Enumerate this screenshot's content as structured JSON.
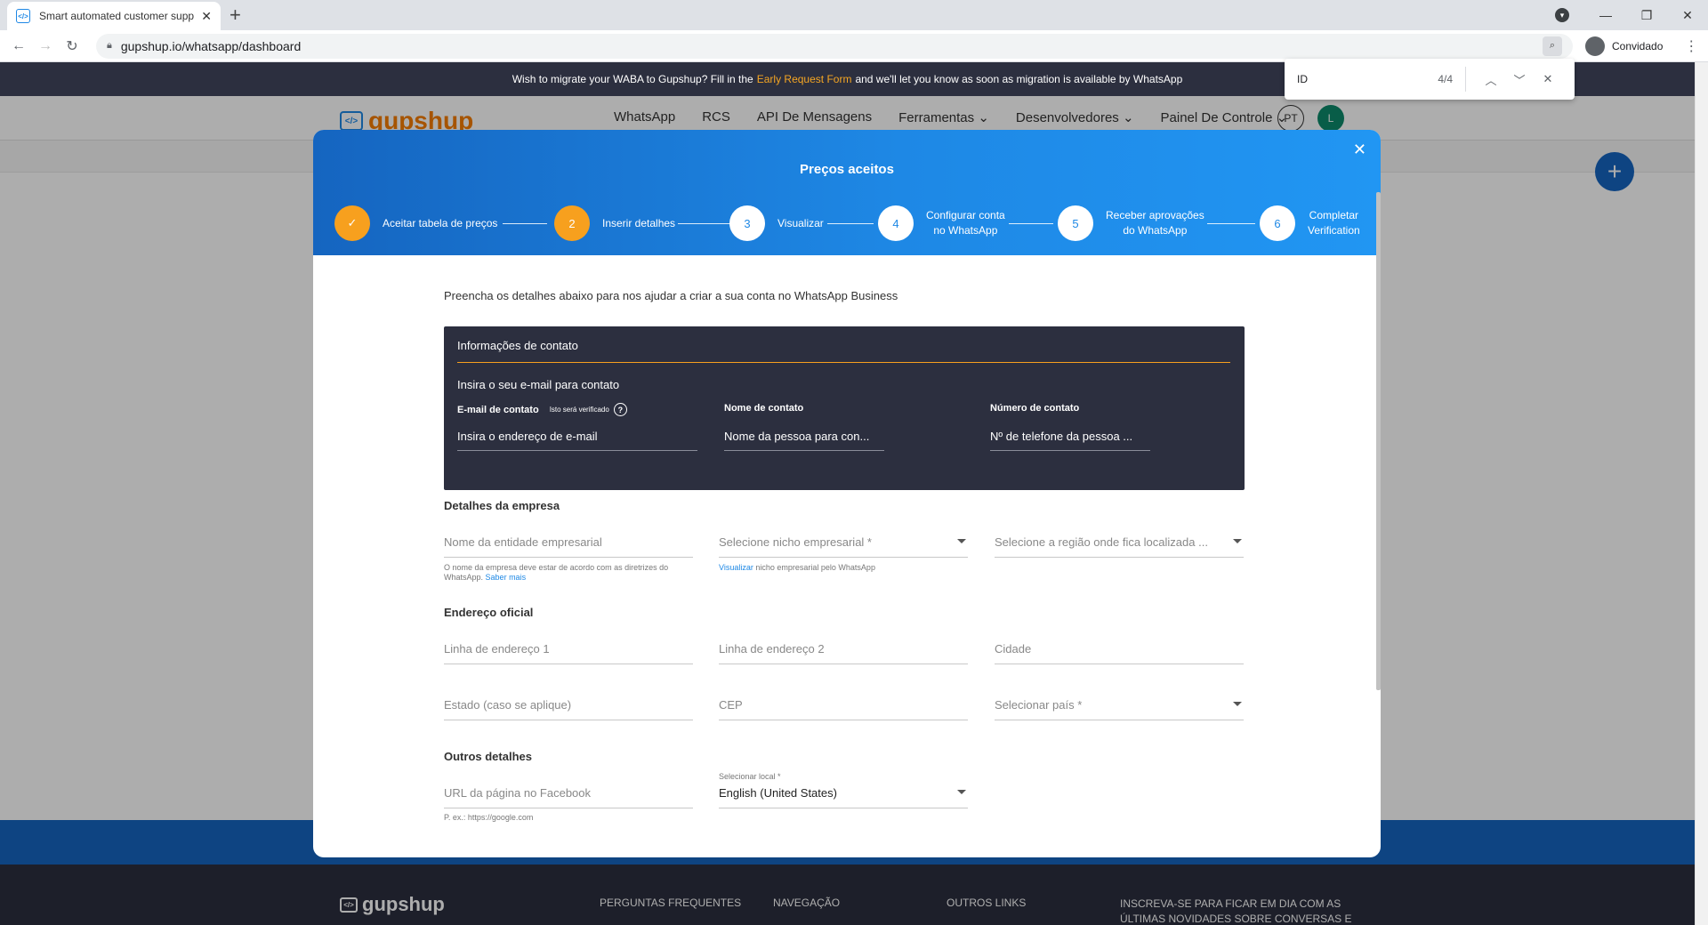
{
  "browser": {
    "tab_title": "Smart automated customer supp",
    "tab_icon": "gupshup-favicon-icon",
    "url": "gupshup.io/whatsapp/dashboard",
    "profile": "Convidado"
  },
  "find": {
    "query": "ID",
    "count": "4/4"
  },
  "banner": {
    "before": "Wish to migrate your WABA to Gupshup? Fill in the",
    "link": "Early Request Form",
    "after": "and we'll let you know as soon as migration is available by WhatsApp"
  },
  "header": {
    "logo": "gupshup",
    "logo_mark": "</>",
    "menu": [
      "WhatsApp",
      "RCS",
      "API De Mensagens",
      "Ferramentas ⌄",
      "Desenvolvedores ⌄",
      "Painel De Controle ⌄"
    ],
    "lang_badge": "PT",
    "avatar": "L"
  },
  "footer": {
    "logo": "gupshup",
    "col1": "PERGUNTAS FREQUENTES",
    "col2": "NAVEGAÇÃO",
    "col3": "OUTROS LINKS",
    "news": "INSCREVA-SE PARA FICAR EM DIA COM AS ÚLTIMAS NOVIDADES SOBRE CONVERSAS E"
  },
  "modal": {
    "title": "Preços aceitos",
    "steps": [
      {
        "num": "✓",
        "label": "Aceitar tabela de preços",
        "state": "done"
      },
      {
        "num": "2",
        "label": "Inserir detalhes",
        "state": "done"
      },
      {
        "num": "3",
        "label": "Visualizar",
        "state": "todo"
      },
      {
        "num": "4",
        "label1": "Configurar conta",
        "label2": "no WhatsApp",
        "state": "todo"
      },
      {
        "num": "5",
        "label1": "Receber aprovações",
        "label2": "do WhatsApp",
        "state": "todo"
      },
      {
        "num": "6",
        "label1": "Completar",
        "label2": "Verification",
        "state": "todo"
      }
    ],
    "intro": "Preencha os detalhes abaixo para nos ajudar a criar a sua conta no WhatsApp Business",
    "contact": {
      "heading": "Informações de contato",
      "subheading": "Insira o seu e-mail para contato",
      "email_label": "E-mail de contato",
      "email_note": "Isto será verificado",
      "email_placeholder": "Insira o endereço de e-mail",
      "name_label": "Nome de contato",
      "name_placeholder": "Nome da pessoa para con...",
      "phone_label": "Número de contato",
      "phone_placeholder": "Nº de telefone da pessoa ..."
    },
    "company": {
      "heading": "Detalhes da empresa",
      "entity_placeholder": "Nome da entidade empresarial",
      "entity_hint": "O nome da empresa deve estar de acordo com as diretrizes do WhatsApp.",
      "entity_hint_link": "Saber mais",
      "niche_placeholder": "Selecione nicho empresarial *",
      "niche_hint_link": "Visualizar",
      "niche_hint": "nicho empresarial pelo WhatsApp",
      "region_placeholder": "Selecione a região onde fica localizada ..."
    },
    "address": {
      "heading": "Endereço oficial",
      "line1": "Linha de endereço 1",
      "line2": "Linha de endereço 2",
      "city": "Cidade",
      "state": "Estado (caso se aplique)",
      "zip": "CEP",
      "country": "Selecionar país *"
    },
    "other": {
      "heading": "Outros detalhes",
      "facebook_placeholder": "URL da página no Facebook",
      "facebook_hint": "P. ex.: https://google.com",
      "locale_label": "Selecionar local *",
      "locale_value": "English (United States)"
    }
  },
  "colors": {
    "accent_orange": "#f7a01e",
    "brand_blue": "#1e88e5",
    "dark_panel": "#2c2f3f"
  }
}
